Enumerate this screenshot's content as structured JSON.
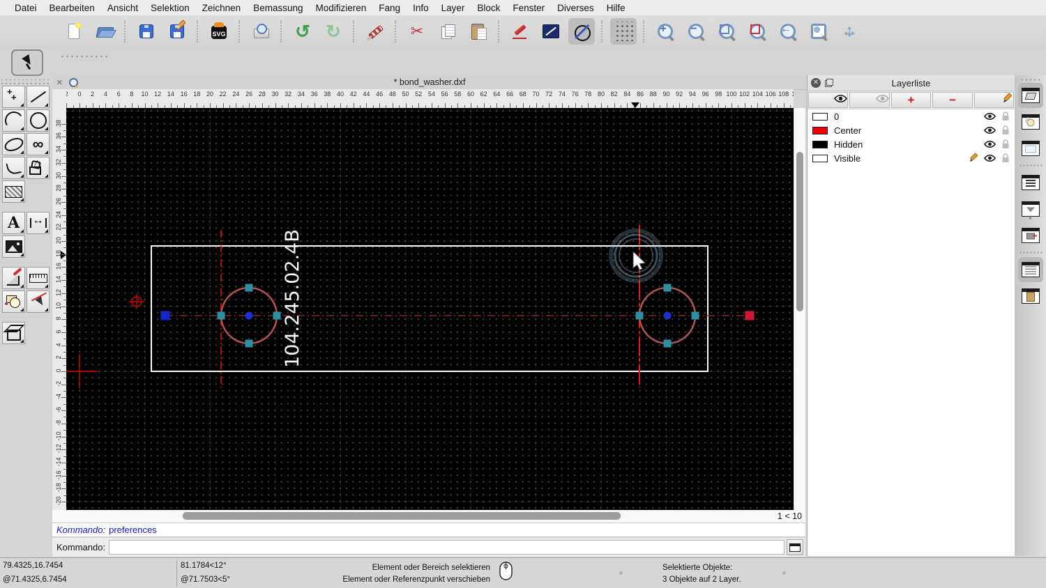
{
  "menubar": {
    "items": [
      "Datei",
      "Bearbeiten",
      "Ansicht",
      "Selektion",
      "Zeichnen",
      "Bemassung",
      "Modifizieren",
      "Fang",
      "Info",
      "Layer",
      "Block",
      "Fenster",
      "Diverses",
      "Hilfe"
    ]
  },
  "toolbar": {
    "buttons": [
      {
        "kind": "btn",
        "name": "new-file-button",
        "icon": "new-file",
        "inter": "true"
      },
      {
        "kind": "btn",
        "name": "open-file-button",
        "icon": "open-file",
        "inter": "true"
      },
      {
        "kind": "sep",
        "name": "toolbar-separator",
        "icon": "separator",
        "inter": "false"
      },
      {
        "kind": "btn",
        "name": "save-button",
        "icon": "save",
        "inter": "true"
      },
      {
        "kind": "btn",
        "name": "save-as-button",
        "icon": "save-as",
        "inter": "true"
      },
      {
        "kind": "sep",
        "name": "toolbar-separator",
        "icon": "separator",
        "inter": "false"
      },
      {
        "kind": "btn",
        "name": "export-svg-button",
        "icon": "export-svg",
        "glyph": "SVG",
        "inter": "true"
      },
      {
        "kind": "sep",
        "name": "toolbar-separator",
        "icon": "separator",
        "inter": "false"
      },
      {
        "kind": "btn",
        "name": "print-preview-button",
        "icon": "print-preview",
        "inter": "true"
      },
      {
        "kind": "sep",
        "name": "toolbar-separator",
        "icon": "separator",
        "inter": "false"
      },
      {
        "kind": "btn",
        "name": "undo-button",
        "icon": "undo",
        "glyph": "↺",
        "inter": "true"
      },
      {
        "kind": "btn",
        "name": "redo-button",
        "icon": "redo",
        "glyph": "↻",
        "inter": "true"
      },
      {
        "kind": "sep",
        "name": "toolbar-separator",
        "icon": "separator",
        "inter": "false"
      },
      {
        "kind": "btn",
        "name": "delete-button",
        "icon": "delete-eraser",
        "inter": "true"
      },
      {
        "kind": "sep",
        "name": "toolbar-separator",
        "icon": "separator",
        "inter": "false"
      },
      {
        "kind": "btn",
        "name": "cut-button",
        "icon": "cut",
        "glyph": "✂",
        "inter": "true"
      },
      {
        "kind": "btn",
        "name": "copy-button",
        "icon": "copy",
        "inter": "true"
      },
      {
        "kind": "btn",
        "name": "paste-button",
        "icon": "paste",
        "inter": "true"
      },
      {
        "kind": "sep",
        "name": "toolbar-separator",
        "icon": "separator",
        "inter": "false"
      },
      {
        "kind": "btn",
        "name": "edit-pen-button",
        "icon": "edit-pen",
        "inter": "true"
      },
      {
        "kind": "btn",
        "name": "attributes-button",
        "icon": "attributes",
        "inter": "true"
      },
      {
        "kind": "btn",
        "name": "draw-order-button",
        "icon": "draw-order",
        "pressed": "1",
        "inter": "true"
      },
      {
        "kind": "sep",
        "name": "toolbar-separator",
        "icon": "separator",
        "inter": "false"
      },
      {
        "kind": "btn",
        "name": "grid-toggle-button",
        "icon": "grid",
        "pressed": "1",
        "inter": "true"
      },
      {
        "kind": "sep",
        "name": "toolbar-separator",
        "icon": "separator",
        "inter": "false"
      },
      {
        "kind": "btn",
        "name": "zoom-in-button",
        "icon": "zoom-in",
        "glyph": "+",
        "inter": "true"
      },
      {
        "kind": "btn",
        "name": "zoom-out-button",
        "icon": "zoom-out",
        "glyph": "−",
        "inter": "true"
      },
      {
        "kind": "btn",
        "name": "zoom-auto-button",
        "icon": "zoom-auto",
        "inter": "true"
      },
      {
        "kind": "btn",
        "name": "zoom-window-button",
        "icon": "zoom-window",
        "inter": "true"
      },
      {
        "kind": "btn",
        "name": "zoom-previous-button",
        "icon": "zoom-previous",
        "glyph": "←",
        "inter": "true"
      },
      {
        "kind": "btn",
        "name": "zoom-view-button",
        "icon": "zoom-view",
        "inter": "true"
      },
      {
        "kind": "btn",
        "name": "zoom-pan-button",
        "icon": "zoom-pan",
        "glyph": "↔",
        "glyph2": "↕",
        "inter": "true"
      }
    ]
  },
  "palette": {
    "tools": [
      {
        "kind": "dots",
        "name": "palette-handle",
        "icon": "none",
        "inter": "false"
      },
      {
        "kind": "tool",
        "name": "points-tool",
        "icon": "points",
        "glyph": "+",
        "glyph2": "+",
        "inter": "true"
      },
      {
        "kind": "tool",
        "name": "line-tool",
        "icon": "line",
        "inter": "true"
      },
      {
        "kind": "tool",
        "name": "arc-tool",
        "icon": "arc",
        "inter": "true"
      },
      {
        "kind": "tool",
        "name": "circle-tool",
        "icon": "circle",
        "inter": "true"
      },
      {
        "kind": "tool",
        "name": "ellipse-tool",
        "icon": "ellipse",
        "inter": "true"
      },
      {
        "kind": "tool",
        "name": "spline-tool",
        "icon": "spline",
        "glyph": "∞",
        "inter": "true"
      },
      {
        "kind": "tool",
        "name": "polyline-tool",
        "icon": "polyline",
        "inter": "true"
      },
      {
        "kind": "tool",
        "name": "shapes-tool",
        "icon": "shapes",
        "glyph": "△",
        "inter": "true"
      },
      {
        "kind": "tool",
        "name": "hatch-tool",
        "icon": "hatch",
        "inter": "true"
      },
      {
        "kind": "blank",
        "name": "empty-cell",
        "icon": "none",
        "inter": "false"
      },
      {
        "kind": "gap",
        "name": "palette-gap",
        "icon": "none",
        "inter": "false"
      },
      {
        "kind": "tool",
        "name": "text-tool",
        "icon": "text",
        "glyph": "A",
        "inter": "true"
      },
      {
        "kind": "tool",
        "name": "dimension-tool",
        "icon": "dimension",
        "glyph": "↔",
        "inter": "true"
      },
      {
        "kind": "tool",
        "name": "image-tool",
        "icon": "image",
        "inter": "true"
      },
      {
        "kind": "blank",
        "name": "empty-cell",
        "icon": "none",
        "inter": "false"
      },
      {
        "kind": "gap",
        "name": "palette-gap",
        "icon": "none",
        "inter": "false"
      },
      {
        "kind": "tool",
        "name": "modify-tool",
        "icon": "modify",
        "inter": "true"
      },
      {
        "kind": "tool",
        "name": "measure-tool",
        "icon": "measure",
        "inter": "true"
      },
      {
        "kind": "tool",
        "name": "block-tool",
        "icon": "block",
        "inter": "true"
      },
      {
        "kind": "tool",
        "name": "select-entity-tool",
        "icon": "select-entity",
        "inter": "true"
      },
      {
        "kind": "gap",
        "name": "palette-gap",
        "icon": "none",
        "inter": "false"
      },
      {
        "kind": "tool",
        "name": "solid-tool",
        "icon": "solid",
        "inter": "true"
      },
      {
        "kind": "blank",
        "name": "empty-cell",
        "icon": "none",
        "inter": "false"
      }
    ]
  },
  "tab": {
    "close": "×",
    "title": "* bond_washer.dxf"
  },
  "rulers": {
    "h": {
      "from": -2,
      "to": 110,
      "step": 2
    },
    "v": {
      "from": -20,
      "to": 38,
      "step": 2
    }
  },
  "canvas": {
    "drawing_text": "104.245.02.4B",
    "zoom_indicator": "1 < 10"
  },
  "colors": {
    "canvas_bg": "#000000",
    "outline_white": "#ffffff",
    "entity_selected": "#b35454",
    "centerline_dark": "#8a2626",
    "centerline_bright": "#ee1212",
    "origin_red": "#d40000",
    "handle_teal": "#2f8fa5",
    "handle_blue": "#1b2fd4",
    "endpoint_blue": "#1526cc",
    "endpoint_red": "#cc1836"
  },
  "layer_panel": {
    "title": "Layerliste",
    "toolbar": [
      {
        "name": "show-all-layers-button",
        "eye": "1",
        "var": "on",
        "inter": "true"
      },
      {
        "name": "hide-all-layers-button",
        "eye": "1",
        "var": "off",
        "inter": "true"
      },
      {
        "name": "add-layer-button",
        "glyph": "+",
        "inter": "true"
      },
      {
        "name": "remove-layer-button",
        "glyph": "−",
        "inter": "true"
      },
      {
        "name": "edit-layer-button",
        "pencil": "1",
        "inter": "true"
      }
    ],
    "layers": [
      {
        "name": "0",
        "swatch": "#ffffff"
      },
      {
        "name": "Center",
        "swatch": "#f00000"
      },
      {
        "name": "Hidden",
        "swatch": "#000000"
      },
      {
        "name": "Visible",
        "swatch": "#ffffff",
        "current": "1"
      }
    ]
  },
  "dock": {
    "buttons": [
      {
        "kind": "btn",
        "name": "layer-list-dock-button",
        "icon": "layer-window",
        "pressed": "1",
        "inter": "true"
      },
      {
        "kind": "btn",
        "name": "block-list-dock-button",
        "icon": "block-window",
        "inter": "true"
      },
      {
        "kind": "btn",
        "name": "library-browser-dock-button",
        "icon": "library-window",
        "inter": "true"
      },
      {
        "kind": "sep",
        "name": "dock-separator",
        "icon": "separator",
        "inter": "false"
      },
      {
        "kind": "btn",
        "name": "pen-palette-dock-button",
        "icon": "list-window",
        "inter": "true"
      },
      {
        "kind": "btn",
        "name": "selection-filter-dock-button",
        "icon": "filter-window",
        "inter": "true"
      },
      {
        "kind": "btn",
        "name": "quick-info-dock-button",
        "icon": "info-window",
        "inter": "true"
      },
      {
        "kind": "sep",
        "name": "dock-separator",
        "icon": "separator",
        "inter": "false"
      },
      {
        "kind": "btn",
        "name": "command-line-dock-button",
        "icon": "command-window",
        "pressed": "1",
        "inter": "true"
      },
      {
        "kind": "btn",
        "name": "clipboard-dock-button",
        "icon": "clipboard-window",
        "inter": "true"
      }
    ]
  },
  "command": {
    "history_label": "Kommando:",
    "history_value": "preferences",
    "prompt_label": "Kommando:",
    "input_value": ""
  },
  "statusbar": {
    "abs_coord": "79.4325,16.7454",
    "rel_coord": "@71.4325,6.7454",
    "polar_abs": "81.1784<12°",
    "polar_rel": "@71.7503<5°",
    "hint_line1": "Element oder Bereich selektieren",
    "hint_line2": "Element oder Referenzpunkt verschieben",
    "selection_line1": "Selektierte Objekte:",
    "selection_line2": "3 Objekte auf 2 Layer."
  }
}
